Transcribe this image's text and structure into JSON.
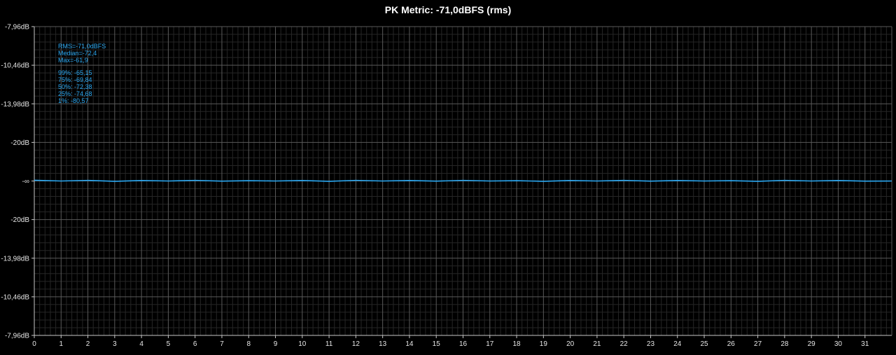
{
  "chart_data": {
    "type": "line",
    "title": "PK Metric: -71,0dBFS (rms)",
    "xlabel": "",
    "ylabel": "",
    "x_ticks": [
      "0",
      "1",
      "2",
      "3",
      "4",
      "5",
      "6",
      "7",
      "8",
      "9",
      "10",
      "11",
      "12",
      "13",
      "14",
      "15",
      "16",
      "17",
      "18",
      "19",
      "20",
      "21",
      "22",
      "23",
      "24",
      "25",
      "26",
      "27",
      "28",
      "29",
      "30",
      "31"
    ],
    "xlim": [
      0,
      32
    ],
    "y_ticks": [
      "-7,96dB",
      "-10,46dB",
      "-13,98dB",
      "-20dB",
      "-∞",
      "-20dB",
      "-13,98dB",
      "-10,46dB",
      "-7,96dB"
    ],
    "ylim": [
      -1,
      1
    ],
    "grid": true,
    "series": [
      {
        "x": [
          0,
          1,
          2,
          3,
          4,
          5,
          6,
          7,
          8,
          9,
          10,
          11,
          12,
          13,
          14,
          15,
          16,
          17,
          18,
          19,
          20,
          21,
          22,
          23,
          24,
          25,
          26,
          27,
          28,
          29,
          30,
          31,
          32
        ],
        "y": [
          0.005,
          0.0,
          0.004,
          -0.002,
          0.003,
          0.0,
          0.004,
          -0.001,
          0.002,
          0.0,
          0.003,
          -0.002,
          0.004,
          0.0,
          0.003,
          -0.001,
          0.004,
          0.0,
          0.002,
          -0.002,
          0.003,
          0.0,
          0.004,
          -0.001,
          0.003,
          0.0,
          0.002,
          -0.002,
          0.004,
          0.0,
          0.003,
          -0.001,
          0.0
        ]
      }
    ],
    "annotations": {
      "rms": "RMS=-71,0dBFS",
      "median": "Median=-72,4",
      "max": "Max=-61,9",
      "p99": "99%: -65,15",
      "p75": "75%: -69,84",
      "p50": "50%: -72,38",
      "p25": "25%: -74,68",
      "p1": "1%: -80,57"
    }
  },
  "colors": {
    "background": "#000000",
    "grid_major": "#5a5a5a",
    "grid_minor": "#262626",
    "axis": "#c8c8c8",
    "series": "#2aa8f2",
    "annotation": "#2aa8f2",
    "title": "#ffffff"
  }
}
